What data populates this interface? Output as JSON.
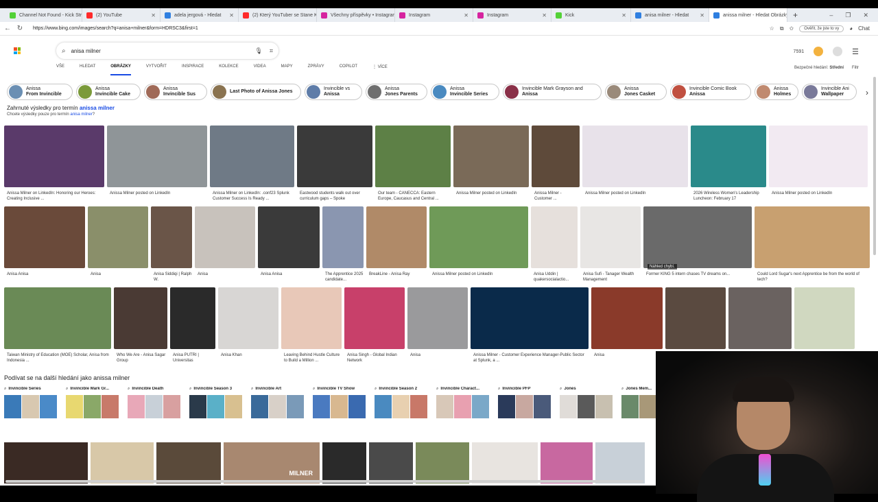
{
  "browser": {
    "tabs": [
      {
        "title": "Channel Not Found - Kick Strea",
        "color": "#53d137"
      },
      {
        "title": "(2) YouTube",
        "color": "#ff2a2a"
      },
      {
        "title": "adela jergová - Hledat",
        "color": "#2f7fe0"
      },
      {
        "title": "(2) Který YouTuber se Stane Král",
        "color": "#ff2a2a"
      },
      {
        "title": "Všechny příspěvky • Instagram",
        "color": "#d6249f"
      },
      {
        "title": "Instagram",
        "color": "#d6249f"
      },
      {
        "title": "Instagram",
        "color": "#d6249f"
      },
      {
        "title": "Kick",
        "color": "#53d137"
      },
      {
        "title": "anisa milner - Hledat",
        "color": "#2f7fe0"
      },
      {
        "title": "anissa milner - Hledat Obrázky",
        "color": "#2f7fe0"
      }
    ],
    "new_tab": "+",
    "window_controls": [
      "–",
      "❐",
      "✕"
    ],
    "url": "https://www.bing.com/images/search?q=anisa+milner&form=HDRSC3&first=1",
    "profile_pill": "Ověřit, že jste to vy",
    "chat_label": "Chat"
  },
  "header": {
    "query": "anisa milner",
    "reward_points": "7591",
    "nav_tabs": [
      "VŠE",
      "HLEDAT",
      "OBRÁZKY",
      "Vytvořit",
      "Inspirace",
      "Kolekce",
      "VIDEA",
      "MAPY",
      "ZPRÁVY",
      "COPILOT",
      "⋮ VÍCE"
    ],
    "safe_search_label": "Bezpečné hledání:",
    "safe_search_value": "Střední",
    "filter_label": "Filtr"
  },
  "pills": [
    {
      "line1": "Anissa",
      "line2": "From Invincible",
      "color": "#6b8fb3"
    },
    {
      "line1": "Anissa",
      "line2": "Invincible Cake",
      "color": "#7b9a3a"
    },
    {
      "line1": "Anissa",
      "line2": "Invincible Sus",
      "color": "#a06a58"
    },
    {
      "line1": "",
      "line2": "Last Photo of Anissa Jones",
      "color": "#8a7350"
    },
    {
      "line1": "Invincible vs",
      "line2": "Anissa",
      "color": "#5e7ca8"
    },
    {
      "line1": "Anissa",
      "line2": "Jones Parents",
      "color": "#6f6f6f"
    },
    {
      "line1": "Anissa",
      "line2": "Invincible Series",
      "color": "#4a8ac0"
    },
    {
      "line1": "Invincible Mark Grayson and",
      "line2": "Anissa",
      "color": "#8a3048"
    },
    {
      "line1": "Anissa",
      "line2": "Jones Casket",
      "color": "#9a8a7a"
    },
    {
      "line1": "Invincible Comic Book",
      "line2": "Anissa",
      "color": "#c05040"
    },
    {
      "line1": "Anissa",
      "line2": "Holmes",
      "color": "#c08a70"
    },
    {
      "line1": "Invincible Ani",
      "line2": "Wallpaper",
      "color": "#7a7a9a"
    }
  ],
  "notice": {
    "prefix": "Zahrnuté výsledky pro termín ",
    "term": "anissa milner",
    "alt_prefix": "Chcete výsledky pouze pro termín ",
    "alt_term": "anisa milner",
    "alt_suffix": "?"
  },
  "rows": [
    [
      {
        "caption": "Anissa Milner on LinkedIn: Honoring our Heroes: Creating Inclusive ...",
        "color": "#5a3a6a"
      },
      {
        "caption": "Anissa Milner posted on LinkedIn",
        "color": "#8f9598"
      },
      {
        "caption": "Anissa Milner on LinkedIn: .conf23 Splunk Customer Success Is Ready ...",
        "color": "#6f7a86"
      },
      {
        "caption": "Eastwood students walk out over curriculum gaps – Spoke",
        "color": "#3a3a3a"
      },
      {
        "caption": "Our team - CANECCA: Eastern Europe, Caucasus and Central ...",
        "color": "#5d8046"
      },
      {
        "caption": "Anissa Milner posted on LinkedIn",
        "color": "#7a6a58"
      },
      {
        "caption": "Anissa Milner - Customer ...",
        "color": "#5e4a3a"
      },
      {
        "caption": "Anissa Milner posted on LinkedIn",
        "color": "#e8e2ea"
      },
      {
        "caption": "2026 Wireless Women's Leadership Luncheon: February 17",
        "color": "#2a8a8a"
      },
      {
        "caption": "Anissa Milner posted on LinkedIn",
        "color": "#f2eaf2"
      }
    ],
    [
      {
        "caption": "Anisa Anisa",
        "color": "#6a4a3a"
      },
      {
        "caption": "Anisa",
        "color": "#8a8f6a"
      },
      {
        "caption": "Anisa Siddiqi | Ralph W.",
        "color": "#6a5548"
      },
      {
        "caption": "Anisa",
        "color": "#c8c2bc"
      },
      {
        "caption": "Anisa Anisa",
        "color": "#3a3a3a"
      },
      {
        "caption": "The Apprentice 2025 candidate...",
        "color": "#8a96b0"
      },
      {
        "caption": "BreakLine - Anisa Ray",
        "color": "#b08a68"
      },
      {
        "caption": "Anissa Milner posted on LinkedIn",
        "color": "#6f9a58"
      },
      {
        "caption": "Anisa Uddin | quakersocialactio...",
        "color": "#e6e0dc"
      },
      {
        "caption": "Anisa Sufi - Tanager Wealth Management",
        "color": "#e8e6e4"
      },
      {
        "caption": "Former KING 5 intern chases TV dreams on...",
        "color": "#6a6a6a"
      },
      {
        "caption": "Could Lord Sugar's next Apprentice be from the world of tech?",
        "color": "#c8a070"
      }
    ],
    [
      {
        "caption": "Taiwan Ministry of Education (MOE) Scholar, Anisa from Indonesia ...",
        "color": "#6a8a56"
      },
      {
        "caption": "Who We Are - Anisa Sagar Group",
        "color": "#4a3a34"
      },
      {
        "caption": "Anisa PUTRI | Universitas",
        "color": "#2a2a2a"
      },
      {
        "caption": "Anisa Khan",
        "color": "#d8d6d4"
      },
      {
        "caption": "Leaving Behind Hustle Culture to Build a Million ...",
        "color": "#e8c8b8"
      },
      {
        "caption": "Anisa Singh - Global Indian Network",
        "color": "#c8406a"
      },
      {
        "caption": "Anisa",
        "color": "#9a9a9c"
      },
      {
        "caption": "Anissa Milner - Customer Experience Manager-Public Sector at Splunk, a ...",
        "color": "#0a2a4a"
      },
      {
        "caption": "Anisa",
        "color": "#8a3a2a"
      },
      {
        "caption": "",
        "color": "#5a4a40"
      },
      {
        "caption": "",
        "color": "#6a6260"
      },
      {
        "caption": "",
        "color": "#d0d8c0"
      }
    ]
  ],
  "image_badge": "Náhled chybí.",
  "related": {
    "title": "Podívat se na další hledání jako anissa milner",
    "items": [
      {
        "label": "Invincible Series",
        "colors": [
          "#3a7ab8",
          "#d8c8b0",
          "#4a8ac8"
        ]
      },
      {
        "label": "Invincible Mark Gr...",
        "colors": [
          "#e8d870",
          "#8aa868",
          "#c87a6a"
        ]
      },
      {
        "label": "Invincible Death",
        "colors": [
          "#e8a8b8",
          "#c8d0d8",
          "#d8a0a0"
        ]
      },
      {
        "label": "Invincible Season 3",
        "colors": [
          "#2a3a4a",
          "#5ab0c8",
          "#d8c090"
        ]
      },
      {
        "label": "Invincible Art",
        "colors": [
          "#3a6a9a",
          "#d8d0c8",
          "#7a9ab8"
        ]
      },
      {
        "label": "Invincible TV Show",
        "colors": [
          "#4a7ac0",
          "#d8b890",
          "#3a6ab0"
        ]
      },
      {
        "label": "Invincible Season 2",
        "colors": [
          "#4a8ac0",
          "#e8d0b0",
          "#c87868"
        ]
      },
      {
        "label": "Invincible Charact...",
        "colors": [
          "#d8c8b8",
          "#e8a0b0",
          "#7aa8c8"
        ]
      },
      {
        "label": "Invincible PFP",
        "colors": [
          "#2a3a5a",
          "#c8a8a0",
          "#4a5a7a"
        ]
      },
      {
        "label": "Jones",
        "colors": [
          "#e0dcd8",
          "#5a5a5a",
          "#c8c0b0"
        ]
      },
      {
        "label": "Jones Mem...",
        "colors": [
          "#6a8a6a",
          "#a89878",
          "#c8c0b0"
        ]
      }
    ]
  },
  "bottom_row": [
    {
      "color": "#3a2a24"
    },
    {
      "color": "#d8c8a8"
    },
    {
      "color": "#5a4a3a"
    },
    {
      "color": "#a88870",
      "text": "MILNER"
    },
    {
      "color": "#2a2a2a"
    },
    {
      "color": "#4a4a4a"
    },
    {
      "color": "#7a8a5a"
    },
    {
      "color": "#e8e4e0"
    },
    {
      "color": "#c868a0"
    },
    {
      "color": "#c8d0d8"
    }
  ]
}
